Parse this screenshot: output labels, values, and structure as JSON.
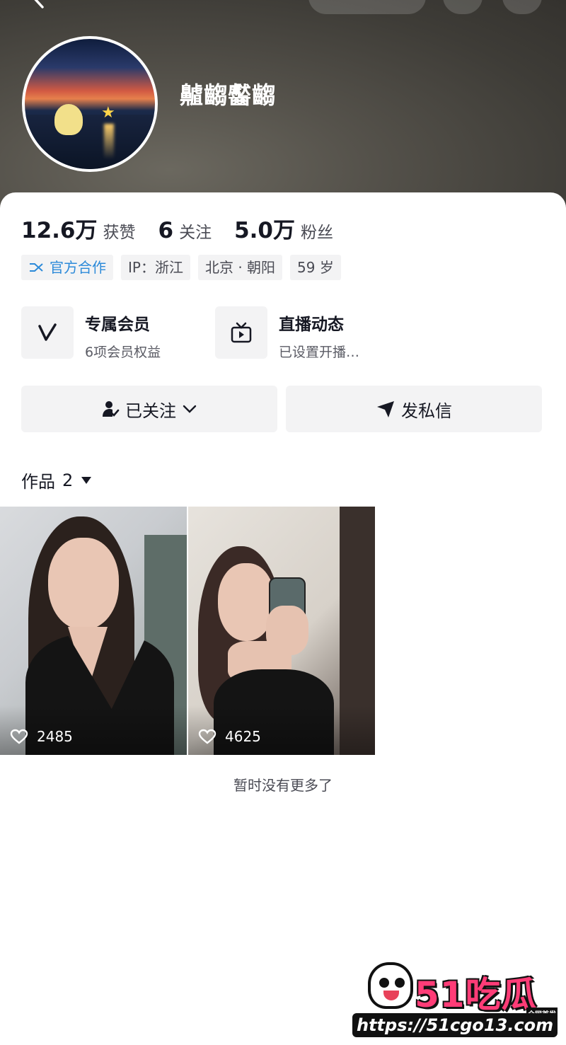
{
  "profile": {
    "nickname": "齇齺齾齺",
    "stats": [
      {
        "value": "12.6万",
        "label": "获赞"
      },
      {
        "value": "6",
        "label": "关注"
      },
      {
        "value": "5.0万",
        "label": "粉丝"
      }
    ],
    "tags": {
      "official": "官方合作",
      "ip": "IP：浙江",
      "location": "北京 · 朝阳",
      "age": "59 岁"
    }
  },
  "features": {
    "vip": {
      "title": "专属会员",
      "subtitle": "6项会员权益",
      "icon": "v-member-icon"
    },
    "live": {
      "title": "直播动态",
      "subtitle": "已设置开播…",
      "icon": "tv-icon"
    }
  },
  "actions": {
    "follow_label": "已关注",
    "message_label": "发私信"
  },
  "works": {
    "label": "作品",
    "count": "2",
    "items": [
      {
        "likes": "2485"
      },
      {
        "likes": "4625"
      }
    ],
    "end_text": "暂时没有更多了"
  },
  "watermark": {
    "brand": "51吃瓜",
    "tag": "全网首发",
    "url": "https://51cgo13.com"
  },
  "colors": {
    "accent_blue": "#2c8ad9",
    "watermark_pink": "#ff3c77",
    "header_bg": "#4f4c46"
  }
}
